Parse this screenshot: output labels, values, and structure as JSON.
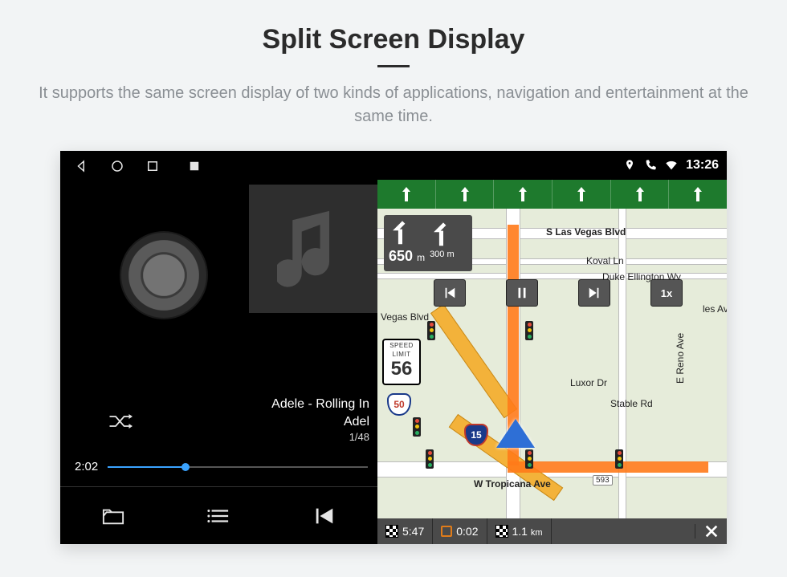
{
  "header": {
    "title": "Split Screen Display",
    "subtitle": "It supports the same screen display of two kinds of applications, navigation and entertainment at the same time."
  },
  "status_bar": {
    "time": "13:26",
    "icons": [
      "location-icon",
      "phone-icon",
      "wifi-icon"
    ]
  },
  "music": {
    "android_nav": [
      "back-icon",
      "home-icon",
      "recent-icon",
      "screenshot-icon"
    ],
    "track_title": "Adele - Rolling In",
    "track_artist": "Adel",
    "track_index": "1/48",
    "elapsed": "2:02",
    "shuffle_on": true,
    "controls": [
      "folder-icon",
      "playlist-icon",
      "previous-track-icon"
    ]
  },
  "navigation": {
    "lane_count": 6,
    "turn": {
      "primary_m": "650",
      "primary_unit": "m",
      "secondary": "300",
      "secondary_unit": "m"
    },
    "controls": {
      "prev": "|◀",
      "pause": "❚❚",
      "next": "▶|",
      "speed": "1x"
    },
    "speed_limit": {
      "label1": "SPEED",
      "label2": "LIMIT",
      "value": "56"
    },
    "shields": {
      "route50": "50",
      "route15": "15"
    },
    "streets": {
      "s1": "S Las Vegas Blvd",
      "s2": "Koval Ln",
      "s3": "Duke Ellington Wy",
      "s4": "Vegas Blvd",
      "s5": "Luxor Dr",
      "s6": "Stable Rd",
      "s7": "E Reno Ave",
      "s8": "W Tropicana Ave",
      "s9": "les Ave",
      "addr": "593"
    },
    "bottom": {
      "eta": "5:47",
      "duration": "0:02",
      "distance_value": "1.1",
      "distance_unit": "km"
    }
  }
}
